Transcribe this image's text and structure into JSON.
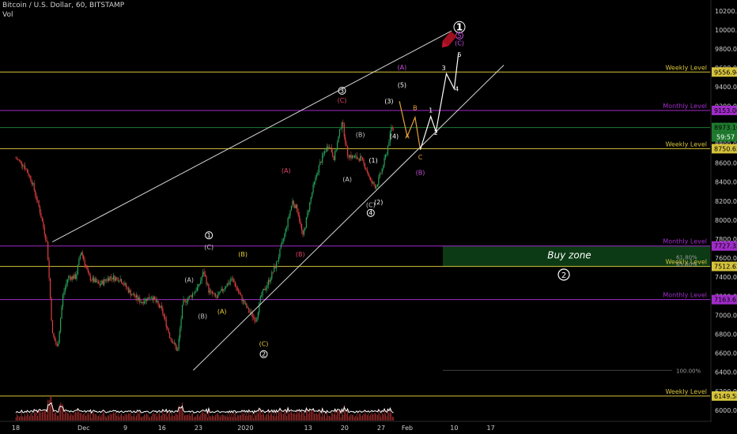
{
  "header": {
    "title": "Bitcoin / U.S. Dollar, 60, BITSTAMP",
    "vol_label": "Vol"
  },
  "chart_data": {
    "type": "candlestick",
    "ylim": [
      5800,
      10300
    ],
    "y_ticks": [
      6000,
      6200,
      6400,
      6600,
      6800,
      7000,
      7200,
      7400,
      7600,
      7800,
      8000,
      8200,
      8400,
      8600,
      8800,
      9000,
      9200,
      9400,
      9600,
      9800,
      10000,
      10200
    ],
    "x_ticks": [
      {
        "label": "18",
        "day": 0
      },
      {
        "label": "Dec",
        "day": 13
      },
      {
        "label": "9",
        "day": 21
      },
      {
        "label": "16",
        "day": 28
      },
      {
        "label": "23",
        "day": 35
      },
      {
        "label": "2020",
        "day": 44
      },
      {
        "label": "13",
        "day": 56
      },
      {
        "label": "20",
        "day": 63
      },
      {
        "label": "27",
        "day": 70
      },
      {
        "label": "Feb",
        "day": 75
      },
      {
        "label": "10",
        "day": 84
      },
      {
        "label": "17",
        "day": 91
      }
    ],
    "price_path": [
      [
        0,
        8650
      ],
      [
        1.5,
        8580
      ],
      [
        3,
        8420
      ],
      [
        4.5,
        8120
      ],
      [
        6,
        7750
      ],
      [
        7,
        6800
      ],
      [
        8,
        6650
      ],
      [
        9,
        7200
      ],
      [
        10,
        7400
      ],
      [
        11.5,
        7400
      ],
      [
        12.5,
        7680
      ],
      [
        14,
        7400
      ],
      [
        16,
        7320
      ],
      [
        18,
        7400
      ],
      [
        20,
        7380
      ],
      [
        22,
        7230
      ],
      [
        24,
        7140
      ],
      [
        26,
        7200
      ],
      [
        28,
        7050
      ],
      [
        29.5,
        6780
      ],
      [
        31,
        6620
      ],
      [
        32,
        7130
      ],
      [
        33.5,
        7200
      ],
      [
        35,
        7300
      ],
      [
        36,
        7460
      ],
      [
        37,
        7250
      ],
      [
        38.5,
        7180
      ],
      [
        40,
        7300
      ],
      [
        41.5,
        7380
      ],
      [
        43,
        7200
      ],
      [
        44.5,
        7050
      ],
      [
        46,
        6950
      ],
      [
        47,
        7200
      ],
      [
        48.5,
        7360
      ],
      [
        50,
        7550
      ],
      [
        51.5,
        7850
      ],
      [
        53,
        8200
      ],
      [
        54,
        8100
      ],
      [
        55,
        7820
      ],
      [
        56,
        8100
      ],
      [
        57,
        8350
      ],
      [
        58,
        8550
      ],
      [
        59,
        8700
      ],
      [
        60,
        8800
      ],
      [
        61,
        8650
      ],
      [
        62.5,
        9050
      ],
      [
        63.5,
        8700
      ],
      [
        64.5,
        8660
      ],
      [
        66,
        8650
      ],
      [
        67,
        8560
      ],
      [
        68,
        8400
      ],
      [
        69,
        8350
      ],
      [
        70,
        8500
      ],
      [
        71,
        8700
      ],
      [
        72,
        8980
      ],
      [
        72.5,
        8950
      ]
    ],
    "horizontal_levels": [
      {
        "price": 9556.94,
        "label": "Weekly Level",
        "tag": "9556.94",
        "color": "#d6c33c"
      },
      {
        "price": 9153.0,
        "label": "Monthly Level",
        "tag": "9153.00",
        "color": "#a02cc8"
      },
      {
        "price": 8973.16,
        "label": "",
        "tag": "8973.16",
        "color": "#1f7a2e"
      },
      {
        "price": 8750.62,
        "label": "Weekly Level",
        "tag": "8750.62",
        "color": "#d6c33c"
      },
      {
        "price": 7727.32,
        "label": "Monthly Level",
        "tag": "7727.32",
        "color": "#a02cc8"
      },
      {
        "price": 7512.62,
        "label": "Weekly Level",
        "tag": "7512.62",
        "color": "#d6c33c"
      },
      {
        "price": 7163.63,
        "label": "Monthly Level",
        "tag": "7163.63",
        "color": "#a02cc8"
      },
      {
        "price": 6149.58,
        "label": "Weekly Level",
        "tag": "6149.58",
        "color": "#d6c33c"
      }
    ],
    "countdown_tag": "59:57",
    "fib_labels": [
      {
        "text": "61.80%",
        "price": 7615
      },
      {
        "text": "65.00%",
        "price": 7540
      },
      {
        "text": "100.00%",
        "price": 6420
      }
    ],
    "buy_zone": {
      "label": "Buy zone",
      "wave": "2",
      "top": 7727.32,
      "bottom": 7512.62
    },
    "trendlines": [
      {
        "from": [
          7,
          7770
        ],
        "to": [
          83.5,
          9990
        ]
      },
      {
        "from": [
          34,
          6420
        ],
        "to": [
          93.5,
          9630
        ]
      }
    ],
    "wave_labels": [
      {
        "text": "1",
        "day": 85,
        "price": 10030,
        "color": "#ffffff",
        "circle": true,
        "big": true
      },
      {
        "text": "5",
        "day": 85,
        "price": 9940,
        "color": "#c84fd8",
        "circle": true
      },
      {
        "text": "(C)",
        "day": 85,
        "price": 9860,
        "color": "#c84fd8"
      },
      {
        "text": "5",
        "day": 85,
        "price": 9740,
        "color": "#ffffff"
      },
      {
        "text": "3",
        "day": 82,
        "price": 9600,
        "color": "#ffffff"
      },
      {
        "text": "4",
        "day": 84.5,
        "price": 9380,
        "color": "#ffffff"
      },
      {
        "text": "(A)",
        "day": 74,
        "price": 9610,
        "color": "#c84fd8"
      },
      {
        "text": "(5)",
        "day": 74,
        "price": 9420,
        "color": "#ffffff"
      },
      {
        "text": "3",
        "day": 62.5,
        "price": 9360,
        "color": "#ffffff",
        "circle": true
      },
      {
        "text": "(C)",
        "day": 62.5,
        "price": 9260,
        "color": "#e0456a"
      },
      {
        "text": "(3)",
        "day": 71.5,
        "price": 9250,
        "color": "#ffffff"
      },
      {
        "text": "B",
        "day": 76.5,
        "price": 9180,
        "color": "#e8a23a"
      },
      {
        "text": "1",
        "day": 79.5,
        "price": 9155,
        "color": "#ffffff"
      },
      {
        "text": "2",
        "day": 80.5,
        "price": 8920,
        "color": "#ffffff"
      },
      {
        "text": "A",
        "day": 75,
        "price": 8880,
        "color": "#e8a23a"
      },
      {
        "text": "(4)",
        "day": 72.5,
        "price": 8880,
        "color": "#ffffff"
      },
      {
        "text": "(B)",
        "day": 66,
        "price": 8900,
        "color": "#c8c8c8"
      },
      {
        "text": "C",
        "day": 77.5,
        "price": 8660,
        "color": "#e8a23a"
      },
      {
        "text": "(B)",
        "day": 77.5,
        "price": 8500,
        "color": "#c84fd8"
      },
      {
        "text": "(1)",
        "day": 68.5,
        "price": 8630,
        "color": "#ffffff"
      },
      {
        "text": "(A)",
        "day": 63.5,
        "price": 8430,
        "color": "#c8c8c8"
      },
      {
        "text": "(A)",
        "day": 51.8,
        "price": 8520,
        "color": "#e0456a"
      },
      {
        "text": "(2)",
        "day": 69.5,
        "price": 8190,
        "color": "#ffffff"
      },
      {
        "text": "(C)",
        "day": 68,
        "price": 8160,
        "color": "#c8c8c8"
      },
      {
        "text": "4",
        "day": 68,
        "price": 8075,
        "color": "#ffffff",
        "circle": true
      },
      {
        "text": "(B)",
        "day": 54.5,
        "price": 7640,
        "color": "#e0456a"
      },
      {
        "text": "1",
        "day": 37,
        "price": 7840,
        "color": "#ffffff",
        "circle": true
      },
      {
        "text": "(C)",
        "day": 37,
        "price": 7715,
        "color": "#c8c8c8"
      },
      {
        "text": "(B)",
        "day": 43.5,
        "price": 7640,
        "color": "#e8d03a"
      },
      {
        "text": "(A)",
        "day": 33.2,
        "price": 7370,
        "color": "#c8c8c8"
      },
      {
        "text": "(A)",
        "day": 39.5,
        "price": 7040,
        "color": "#e8d03a"
      },
      {
        "text": "(B)",
        "day": 35.8,
        "price": 6990,
        "color": "#c8c8c8"
      },
      {
        "text": "(C)",
        "day": 47.5,
        "price": 6700,
        "color": "#e8d03a"
      },
      {
        "text": "2",
        "day": 47.5,
        "price": 6590,
        "color": "#ffffff",
        "circle": true
      }
    ],
    "projection_orange": [
      [
        73.5,
        9250
      ],
      [
        75,
        8880
      ],
      [
        76.5,
        9080
      ],
      [
        77.5,
        8740
      ]
    ],
    "projection_white": [
      [
        77.5,
        8740
      ],
      [
        79.5,
        9090
      ],
      [
        80.5,
        8930
      ],
      [
        82.5,
        9540
      ],
      [
        84,
        9380
      ],
      [
        84.8,
        9750
      ]
    ],
    "volume_ylim": [
      0,
      100
    ],
    "marker_icon": "pencil-icon",
    "colors": {
      "up_candle": "#26a65b",
      "down_candle": "#e04040",
      "volume_line": "#ffffff",
      "volume_bar": "#b03030",
      "buy_zone_fill": "#0c3a14"
    }
  }
}
